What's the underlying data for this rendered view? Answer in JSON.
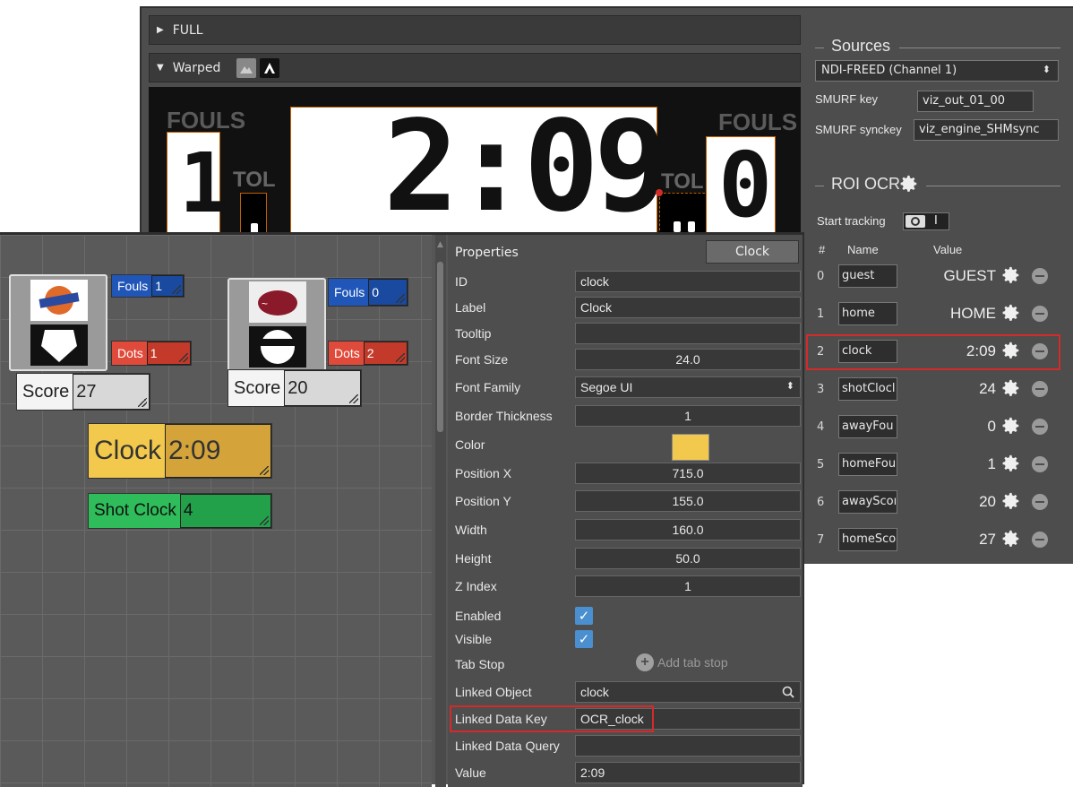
{
  "preview": {
    "full_label": "FULL",
    "warped_label": "Warped",
    "scoreboard": {
      "fouls_left": "FOULS",
      "fouls_right": "FOULS",
      "tol_left": "TOL",
      "tol_right": "TOL",
      "left_digit": "1",
      "clock": "2:09",
      "right_digit": "0"
    }
  },
  "sources": {
    "title": "Sources",
    "selected_source": "NDI-FREED (Channel 1)",
    "smurf_key_label": "SMURF key",
    "smurf_key_value": "viz_out_01_00",
    "smurf_synckey_label": "SMURF synckey",
    "smurf_synckey_value": "viz_engine_SHMsync"
  },
  "roi_ocr": {
    "title": "ROI OCR",
    "start_tracking_label": "Start tracking",
    "toggle_on": "I",
    "col_index": "#",
    "col_name": "Name",
    "col_value": "Value",
    "rows": [
      {
        "index": "0",
        "name": "guest",
        "value": "GUEST"
      },
      {
        "index": "1",
        "name": "home",
        "value": "HOME"
      },
      {
        "index": "2",
        "name": "clock",
        "value": "2:09"
      },
      {
        "index": "3",
        "name": "shotClocl",
        "value": "24"
      },
      {
        "index": "4",
        "name": "awayFou",
        "value": "0"
      },
      {
        "index": "5",
        "name": "homeFou",
        "value": "1"
      },
      {
        "index": "6",
        "name": "awayScoı",
        "value": "20"
      },
      {
        "index": "7",
        "name": "homeSco",
        "value": "27"
      }
    ]
  },
  "canvas": {
    "away": {
      "fouls_label": "Fouls",
      "fouls_value": "1",
      "dots_label": "Dots",
      "dots_value": "1",
      "score_label": "Score",
      "score_value": "27"
    },
    "home": {
      "fouls_label": "Fouls",
      "fouls_value": "0",
      "dots_label": "Dots",
      "dots_value": "2",
      "score_label": "Score",
      "score_value": "20"
    },
    "clock": {
      "label": "Clock",
      "value": "2:09"
    },
    "shot_clock": {
      "label": "Shot Clock",
      "value": "4"
    }
  },
  "properties": {
    "title": "Properties",
    "tab": "Clock",
    "id_label": "ID",
    "id_value": "clock",
    "label_label": "Label",
    "label_value": "Clock",
    "tooltip_label": "Tooltip",
    "tooltip_value": "",
    "font_size_label": "Font Size",
    "font_size_value": "24.0",
    "font_family_label": "Font Family",
    "font_family_value": "Segoe UI",
    "border_label": "Border Thickness",
    "border_value": "1",
    "color_label": "Color",
    "color_value": "#f2c94c",
    "pos_x_label": "Position X",
    "pos_x_value": "715.0",
    "pos_y_label": "Position Y",
    "pos_y_value": "155.0",
    "width_label": "Width",
    "width_value": "160.0",
    "height_label": "Height",
    "height_value": "50.0",
    "z_label": "Z Index",
    "z_value": "1",
    "enabled_label": "Enabled",
    "enabled": true,
    "visible_label": "Visible",
    "visible": true,
    "tab_stop_label": "Tab Stop",
    "add_tab_stop": "Add tab stop",
    "linked_object_label": "Linked Object",
    "linked_object_value": "clock",
    "linked_key_label": "Linked Data Key",
    "linked_key_value": "OCR_clock",
    "linked_query_label": "Linked Data Query",
    "linked_query_value": "",
    "value_label": "Value",
    "value_value": "2:09"
  },
  "colors": {
    "highlight": "#d42a2a",
    "clock_widget": "#f2c94c",
    "shot_clock_widget": "#2ebd5a",
    "fouls_widget": "#1f56b8",
    "dots_widget": "#e04a3a",
    "checkbox": "#4a8fcf"
  }
}
